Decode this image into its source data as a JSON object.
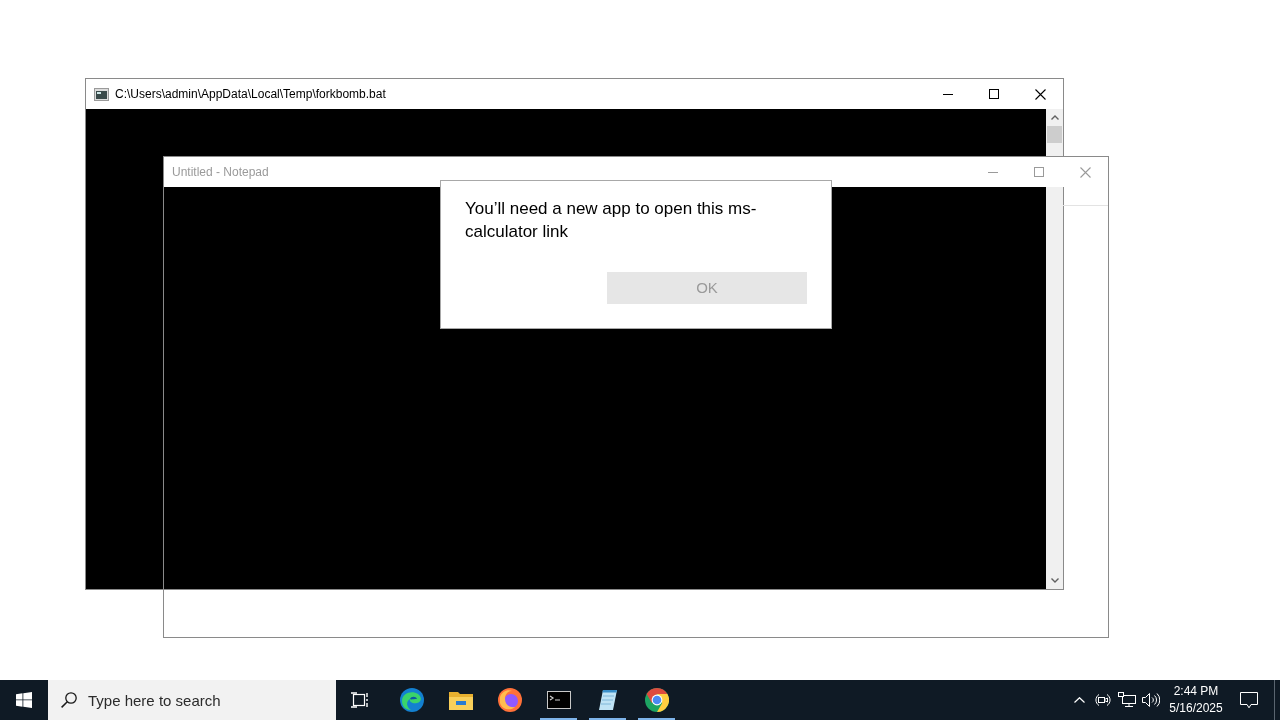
{
  "windows": [
    {
      "kind": "console",
      "title": "C:\\Users\\admin\\AppData\\Local\\Temp\\forkbomb.bat",
      "active": true
    },
    {
      "kind": "notepad",
      "title": "Untitled - Notepad",
      "active": false
    }
  ],
  "dialog": {
    "message": "You’ll need a new app to open this ms-calculator link",
    "button": {
      "label": "OK",
      "disabled": true
    }
  },
  "taskbar": {
    "search": {
      "placeholder": "Type here to search"
    },
    "apps": [
      {
        "kind": "task-view",
        "running": false
      },
      {
        "kind": "edge",
        "running": false
      },
      {
        "kind": "file-explorer",
        "running": false
      },
      {
        "kind": "firefox",
        "running": false
      },
      {
        "kind": "terminal",
        "running": true
      },
      {
        "kind": "notepad",
        "running": true
      },
      {
        "kind": "chrome",
        "running": true
      }
    ],
    "tray": {
      "time": "2:44 PM",
      "date": "5/16/2025"
    }
  }
}
